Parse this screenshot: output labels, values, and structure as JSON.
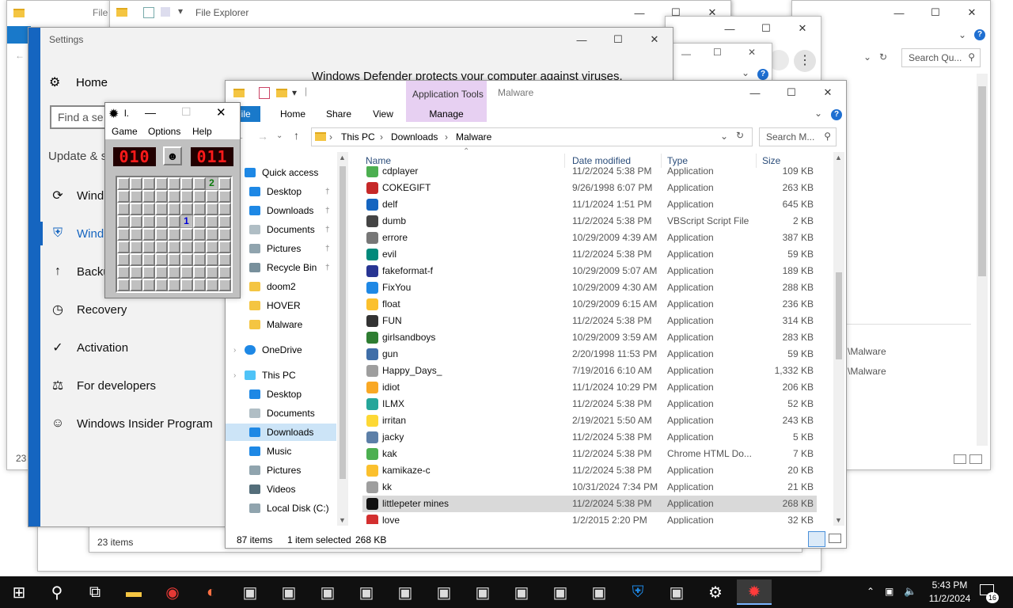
{
  "bg_windows": {
    "explorer_back_title": "File Explorer",
    "explorer_back_tab_file": "File",
    "right_search": "Search Qu...",
    "right_paths": [
      "\\Malware",
      "\\Malware"
    ],
    "back_status_left": "23",
    "back2_status": "23 items",
    "defender_text": "Windows Defender protects your computer against viruses."
  },
  "settings": {
    "title": "Settings",
    "home": "Home",
    "search_placeholder": "Find a se",
    "section": "Update & s",
    "items": [
      {
        "label": "Wind",
        "icon": "sync-icon"
      },
      {
        "label": "Wind",
        "icon": "shield-icon"
      },
      {
        "label": "Backu",
        "icon": "backup-arrow-icon"
      },
      {
        "label": "Recovery",
        "icon": "recovery-icon"
      },
      {
        "label": "Activation",
        "icon": "activation-check-icon"
      },
      {
        "label": "For developers",
        "icon": "developer-tools-icon"
      },
      {
        "label": "Windows Insider Program",
        "icon": "insider-icon"
      }
    ]
  },
  "minesweeper": {
    "title": "l.",
    "menus": [
      "Game",
      "Options",
      "Help"
    ],
    "mine_counter": "010",
    "timer": "011",
    "revealed": [
      {
        "row": 0,
        "col": 7,
        "value": "2",
        "color": "#0a7a0a"
      },
      {
        "row": 3,
        "col": 5,
        "value": "1",
        "color": "#0000d8"
      }
    ]
  },
  "explorer": {
    "ribbon_context": "Application Tools",
    "window_title": "Malware",
    "tabs": [
      "File",
      "Home",
      "Share",
      "View"
    ],
    "manage": "Manage",
    "breadcrumb": [
      "This PC",
      "Downloads",
      "Malware"
    ],
    "search_placeholder": "Search M...",
    "columns": [
      "Name",
      "Date modified",
      "Type",
      "Size"
    ],
    "nav": [
      {
        "label": "Quick access",
        "icon": "star-icon",
        "pinned": false,
        "level": 0
      },
      {
        "label": "Desktop",
        "icon": "desktop-icon",
        "pinned": true,
        "level": 1
      },
      {
        "label": "Downloads",
        "icon": "download-icon",
        "pinned": true,
        "level": 1
      },
      {
        "label": "Documents",
        "icon": "documents-icon",
        "pinned": true,
        "level": 1
      },
      {
        "label": "Pictures",
        "icon": "pictures-icon",
        "pinned": true,
        "level": 1
      },
      {
        "label": "Recycle Bin",
        "icon": "recycle-bin-icon",
        "pinned": true,
        "level": 1
      },
      {
        "label": "doom2",
        "icon": "folder-icon",
        "pinned": false,
        "level": 1
      },
      {
        "label": "HOVER",
        "icon": "folder-icon",
        "pinned": false,
        "level": 1
      },
      {
        "label": "Malware",
        "icon": "folder-icon",
        "pinned": false,
        "level": 1
      },
      {
        "label": "OneDrive",
        "icon": "cloud-icon",
        "pinned": false,
        "level": 0
      },
      {
        "label": "This PC",
        "icon": "computer-icon",
        "pinned": false,
        "level": 0
      },
      {
        "label": "Desktop",
        "icon": "desktop-icon",
        "pinned": false,
        "level": 1
      },
      {
        "label": "Documents",
        "icon": "documents-icon",
        "pinned": false,
        "level": 1
      },
      {
        "label": "Downloads",
        "icon": "download-icon",
        "pinned": false,
        "level": 1,
        "selected": true
      },
      {
        "label": "Music",
        "icon": "music-icon",
        "pinned": false,
        "level": 1
      },
      {
        "label": "Pictures",
        "icon": "pictures-icon",
        "pinned": false,
        "level": 1
      },
      {
        "label": "Videos",
        "icon": "videos-icon",
        "pinned": false,
        "level": 1
      },
      {
        "label": "Local Disk (C:)",
        "icon": "disk-icon",
        "pinned": false,
        "level": 1
      }
    ],
    "files": [
      {
        "name": "cdplayer",
        "date": "11/2/2024 5:38 PM",
        "type": "Application",
        "size": "109 KB",
        "color": "#4caf50"
      },
      {
        "name": "COKEGIFT",
        "date": "9/26/1998 6:07 PM",
        "type": "Application",
        "size": "263 KB",
        "color": "#c62828"
      },
      {
        "name": "delf",
        "date": "11/1/2024 1:51 PM",
        "type": "Application",
        "size": "645 KB",
        "color": "#1565c0"
      },
      {
        "name": "dumb",
        "date": "11/2/2024 5:38 PM",
        "type": "VBScript Script File",
        "size": "2 KB",
        "color": "#444444"
      },
      {
        "name": "errore",
        "date": "10/29/2009 4:39 AM",
        "type": "Application",
        "size": "387 KB",
        "color": "#777777"
      },
      {
        "name": "evil",
        "date": "11/2/2024 5:38 PM",
        "type": "Application",
        "size": "59 KB",
        "color": "#00897b"
      },
      {
        "name": "fakeformat-f",
        "date": "10/29/2009 5:07 AM",
        "type": "Application",
        "size": "189 KB",
        "color": "#283593"
      },
      {
        "name": "FixYou",
        "date": "10/29/2009 4:30 AM",
        "type": "Application",
        "size": "288 KB",
        "color": "#1e88e5"
      },
      {
        "name": "float",
        "date": "10/29/2009 6:15 AM",
        "type": "Application",
        "size": "236 KB",
        "color": "#fbc02d"
      },
      {
        "name": "FUN",
        "date": "11/2/2024 5:38 PM",
        "type": "Application",
        "size": "314 KB",
        "color": "#333333"
      },
      {
        "name": "girlsandboys",
        "date": "10/29/2009 3:59 AM",
        "type": "Application",
        "size": "283 KB",
        "color": "#2e7d32"
      },
      {
        "name": "gun",
        "date": "2/20/1998 11:53 PM",
        "type": "Application",
        "size": "59 KB",
        "color": "#3f6ea8"
      },
      {
        "name": "Happy_Days_",
        "date": "7/19/2016 6:10 AM",
        "type": "Application",
        "size": "1,332 KB",
        "color": "#9e9e9e"
      },
      {
        "name": "idiot",
        "date": "11/1/2024 10:29 PM",
        "type": "Application",
        "size": "206 KB",
        "color": "#f9a825"
      },
      {
        "name": "ILMX",
        "date": "11/2/2024 5:38 PM",
        "type": "Application",
        "size": "52 KB",
        "color": "#26a69a"
      },
      {
        "name": "irritan",
        "date": "2/19/2021 5:50 AM",
        "type": "Application",
        "size": "243 KB",
        "color": "#fdd835"
      },
      {
        "name": "jacky",
        "date": "11/2/2024 5:38 PM",
        "type": "Application",
        "size": "5 KB",
        "color": "#5c7fa8"
      },
      {
        "name": "kak",
        "date": "11/2/2024 5:38 PM",
        "type": "Chrome HTML Do...",
        "size": "7 KB",
        "color": "#4caf50"
      },
      {
        "name": "kamikaze-c",
        "date": "11/2/2024 5:38 PM",
        "type": "Application",
        "size": "20 KB",
        "color": "#fbc02d"
      },
      {
        "name": "kk",
        "date": "10/31/2024 7:34 PM",
        "type": "Application",
        "size": "21 KB",
        "color": "#9e9e9e"
      },
      {
        "name": "littlepeter mines",
        "date": "11/2/2024 5:38 PM",
        "type": "Application",
        "size": "268 KB",
        "color": "#111111",
        "selected": true
      },
      {
        "name": "love",
        "date": "1/2/2015 2:20 PM",
        "type": "Application",
        "size": "32 KB",
        "color": "#d32f2f"
      }
    ],
    "status_count": "87 items",
    "status_selected": "1 item selected",
    "status_size": "268 KB"
  },
  "taskbar": {
    "time": "5:43 PM",
    "date": "11/2/2024",
    "notification_count": "16",
    "pinned": [
      "windows-start-icon",
      "search-icon",
      "task-view-icon",
      "file-explorer-icon",
      "chrome-icon",
      "firefox-icon",
      "app-icon",
      "app-icon",
      "app-icon",
      "app-icon",
      "app-icon",
      "app-icon",
      "app-icon",
      "app-icon",
      "app-icon",
      "app-icon",
      "defender-shield-icon",
      "app-icon",
      "settings-gear-icon",
      "minesweeper-icon"
    ]
  }
}
